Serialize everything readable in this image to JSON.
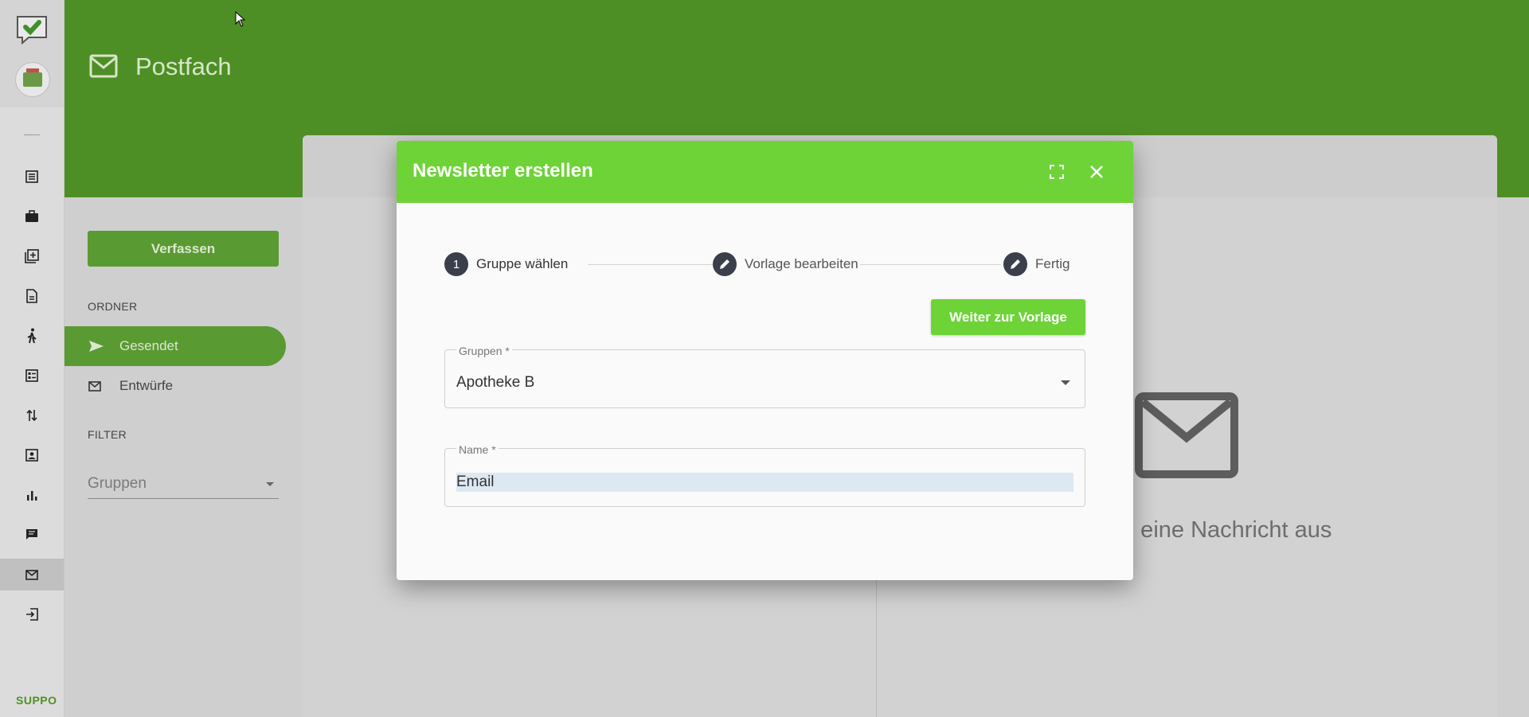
{
  "app": {
    "page_title": "Postfach",
    "support_label": "SUPPO"
  },
  "rail": {
    "icons": [
      "list-icon",
      "briefcase-icon",
      "add-box-icon",
      "document-icon",
      "walk-icon",
      "form-icon",
      "swap-icon",
      "contact-icon",
      "bar-chart-icon",
      "chat-icon",
      "mail-icon",
      "logout-icon"
    ],
    "active": "mail-icon"
  },
  "sidebar": {
    "compose_label": "Verfassen",
    "folders_heading": "ORDNER",
    "folders": [
      {
        "label": "Gesendet",
        "icon": "send-icon",
        "active": true
      },
      {
        "label": "Entwürfe",
        "icon": "mail-icon",
        "active": false
      }
    ],
    "filter_heading": "FILTER",
    "filter_placeholder": "Gruppen"
  },
  "main": {
    "empty_text": "e eine Nachricht aus"
  },
  "modal": {
    "title": "Newsletter erstellen",
    "steps": [
      {
        "marker": "1",
        "label": "Gruppe wählen",
        "icon": "number"
      },
      {
        "marker": "",
        "label": "Vorlage bearbeiten",
        "icon": "pencil-icon"
      },
      {
        "marker": "",
        "label": "Fertig",
        "icon": "pencil-icon"
      }
    ],
    "next_button": "Weiter zur Vorlage",
    "groups_field": {
      "label": "Gruppen *",
      "value": "Apotheke B"
    },
    "name_field": {
      "label": "Name *",
      "value": "Email"
    }
  },
  "colors": {
    "header_green": "#4d8f25",
    "modal_green": "#6dd337",
    "accent_green": "#5a9a32"
  }
}
